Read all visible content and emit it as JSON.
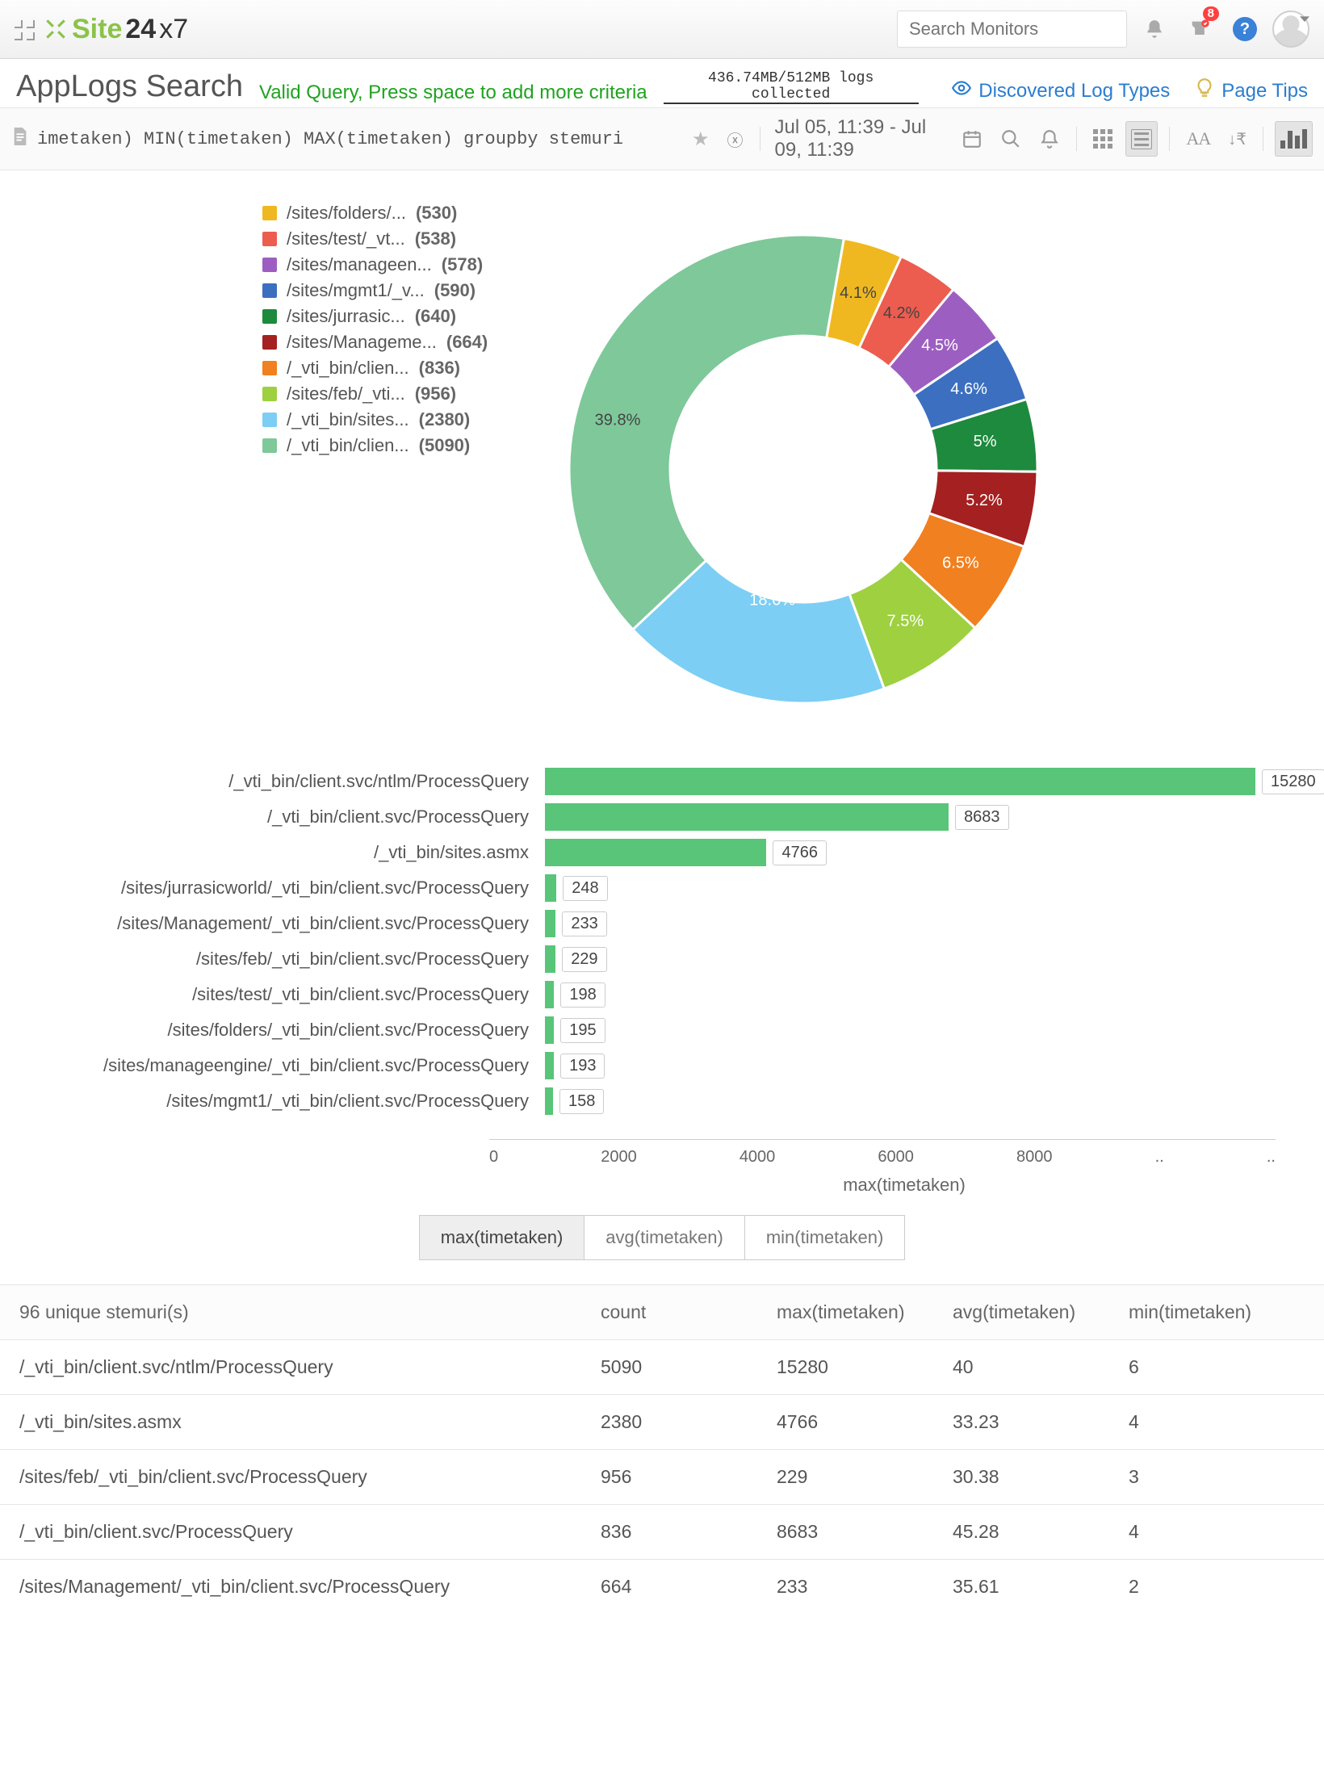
{
  "header": {
    "brand_site": "Site",
    "brand_247": "24",
    "brand_x7": "x7",
    "search_placeholder": "Search Monitors",
    "notif_badge": "8"
  },
  "sub": {
    "title": "AppLogs Search",
    "valid": "Valid Query, Press space to add more criteria",
    "collected": "436.74MB/512MB logs collected",
    "discovered": "Discovered Log Types",
    "tips": "Page Tips"
  },
  "toolbar": {
    "query": "imetaken) MIN(timetaken) MAX(timetaken) groupby stemuri",
    "date": "Jul 05, 11:39 - Jul 09, 11:39"
  },
  "pie_legend": [
    {
      "color": "#f0b820",
      "label": "/sites/folders/...",
      "count": "(530)"
    },
    {
      "color": "#ec5d4f",
      "label": "/sites/test/_vt...",
      "count": "(538)"
    },
    {
      "color": "#9c5fc1",
      "label": "/sites/manageen...",
      "count": "(578)"
    },
    {
      "color": "#3c6fc0",
      "label": "/sites/mgmt1/_v...",
      "count": "(590)"
    },
    {
      "color": "#1d8a3d",
      "label": "/sites/jurrasic...",
      "count": "(640)"
    },
    {
      "color": "#a52020",
      "label": "/sites/Manageme...",
      "count": "(664)"
    },
    {
      "color": "#f08020",
      "label": "/_vti_bin/clien...",
      "count": "(836)"
    },
    {
      "color": "#9ed040",
      "label": "/sites/feb/_vti...",
      "count": "(956)"
    },
    {
      "color": "#7ccef4",
      "label": "/_vti_bin/sites...",
      "count": "(2380)"
    },
    {
      "color": "#7ec89a",
      "label": "/_vti_bin/clien...",
      "count": "(5090)"
    }
  ],
  "donut_center": "39.8%",
  "bars": {
    "max": 15280,
    "items": [
      {
        "label": "/_vti_bin/client.svc/ntlm/ProcessQuery",
        "val": 15280
      },
      {
        "label": "/_vti_bin/client.svc/ProcessQuery",
        "val": 8683
      },
      {
        "label": "/_vti_bin/sites.asmx",
        "val": 4766
      },
      {
        "label": "/sites/jurrasicworld/_vti_bin/client.svc/ProcessQuery",
        "val": 248
      },
      {
        "label": "/sites/Management/_vti_bin/client.svc/ProcessQuery",
        "val": 233
      },
      {
        "label": "/sites/feb/_vti_bin/client.svc/ProcessQuery",
        "val": 229
      },
      {
        "label": "/sites/test/_vti_bin/client.svc/ProcessQuery",
        "val": 198
      },
      {
        "label": "/sites/folders/_vti_bin/client.svc/ProcessQuery",
        "val": 195
      },
      {
        "label": "/sites/manageengine/_vti_bin/client.svc/ProcessQuery",
        "val": 193
      },
      {
        "label": "/sites/mgmt1/_vti_bin/client.svc/ProcessQuery",
        "val": 158
      }
    ],
    "x_ticks": [
      "0",
      "2000",
      "4000",
      "6000",
      "8000",
      "..",
      ".."
    ],
    "x_title": "max(timetaken)",
    "tabs": [
      "max(timetaken)",
      "avg(timetaken)",
      "min(timetaken)"
    ]
  },
  "table": {
    "title": "96 unique stemuri(s)",
    "cols": [
      "count",
      "max(timetaken)",
      "avg(timetaken)",
      "min(timetaken)"
    ],
    "rows": [
      {
        "uri": "/_vti_bin/client.svc/ntlm/ProcessQuery",
        "c": "5090",
        "mx": "15280",
        "av": "40",
        "mn": "6"
      },
      {
        "uri": "/_vti_bin/sites.asmx",
        "c": "2380",
        "mx": "4766",
        "av": "33.23",
        "mn": "4"
      },
      {
        "uri": "/sites/feb/_vti_bin/client.svc/ProcessQuery",
        "c": "956",
        "mx": "229",
        "av": "30.38",
        "mn": "3"
      },
      {
        "uri": "/_vti_bin/client.svc/ProcessQuery",
        "c": "836",
        "mx": "8683",
        "av": "45.28",
        "mn": "4"
      },
      {
        "uri": "/sites/Management/_vti_bin/client.svc/ProcessQuery",
        "c": "664",
        "mx": "233",
        "av": "35.61",
        "mn": "2"
      }
    ]
  },
  "chart_data": [
    {
      "type": "pie",
      "title": "",
      "series": [
        {
          "name": "/sites/folders/...",
          "value": 530,
          "percent": 4.1,
          "color": "#f0b820"
        },
        {
          "name": "/sites/test/_vt...",
          "value": 538,
          "percent": 4.2,
          "color": "#ec5d4f"
        },
        {
          "name": "/sites/manageen...",
          "value": 578,
          "percent": 4.5,
          "color": "#9c5fc1"
        },
        {
          "name": "/sites/mgmt1/_v...",
          "value": 590,
          "percent": 4.6,
          "color": "#3c6fc0"
        },
        {
          "name": "/sites/jurrasic...",
          "value": 640,
          "percent": 5.0,
          "color": "#1d8a3d"
        },
        {
          "name": "/sites/Manageme...",
          "value": 664,
          "percent": 5.2,
          "color": "#a52020"
        },
        {
          "name": "/_vti_bin/clien...",
          "value": 836,
          "percent": 6.5,
          "color": "#f08020"
        },
        {
          "name": "/sites/feb/_vti...",
          "value": 956,
          "percent": 7.5,
          "color": "#9ed040"
        },
        {
          "name": "/_vti_bin/sites...",
          "value": 2380,
          "percent": 18.6,
          "color": "#7ccef4"
        },
        {
          "name": "/_vti_bin/clien...",
          "value": 5090,
          "percent": 39.8,
          "color": "#7ec89a"
        }
      ]
    },
    {
      "type": "bar",
      "orientation": "horizontal",
      "title": "",
      "xlabel": "max(timetaken)",
      "ylabel": "",
      "xlim": [
        0,
        16000
      ],
      "categories": [
        "/_vti_bin/client.svc/ntlm/ProcessQuery",
        "/_vti_bin/client.svc/ProcessQuery",
        "/_vti_bin/sites.asmx",
        "/sites/jurrasicworld/_vti_bin/client.svc/ProcessQuery",
        "/sites/Management/_vti_bin/client.svc/ProcessQuery",
        "/sites/feb/_vti_bin/client.svc/ProcessQuery",
        "/sites/test/_vti_bin/client.svc/ProcessQuery",
        "/sites/folders/_vti_bin/client.svc/ProcessQuery",
        "/sites/manageengine/_vti_bin/client.svc/ProcessQuery",
        "/sites/mgmt1/_vti_bin/client.svc/ProcessQuery"
      ],
      "values": [
        15280,
        8683,
        4766,
        248,
        233,
        229,
        198,
        195,
        193,
        158
      ]
    }
  ]
}
